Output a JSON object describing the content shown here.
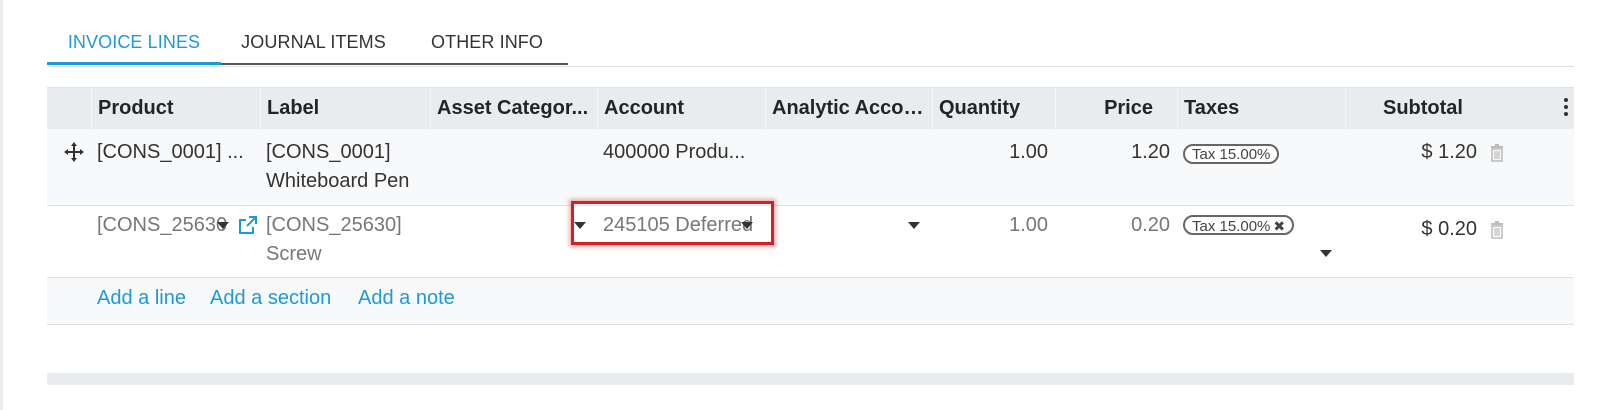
{
  "tabs": [
    {
      "label": "INVOICE LINES",
      "active": true
    },
    {
      "label": "JOURNAL ITEMS",
      "active": false
    },
    {
      "label": "OTHER INFO",
      "active": false
    }
  ],
  "columns": {
    "product": "Product",
    "label": "Label",
    "asset_category": "Asset Categor...",
    "account": "Account",
    "analytic_account": "Analytic Accou...",
    "quantity": "Quantity",
    "price": "Price",
    "taxes": "Taxes",
    "subtotal": "Subtotal"
  },
  "rows": [
    {
      "product": "[CONS_0001] ...",
      "label_line1": "[CONS_0001]",
      "label_line2": "Whiteboard Pen",
      "account": "400000 Produ...",
      "quantity": "1.00",
      "price": "1.20",
      "tax": "Tax 15.00%",
      "subtotal": "$ 1.20"
    },
    {
      "product": "[CONS_25630",
      "label_line1": "[CONS_25630]",
      "label_line2": "Screw",
      "account": "245105 Deferred",
      "quantity": "1.00",
      "price": "0.20",
      "tax": "Tax 15.00%",
      "subtotal": "$ 0.20"
    }
  ],
  "actions": {
    "add_line": "Add a line",
    "add_section": "Add a section",
    "add_note": "Add a note"
  },
  "colors": {
    "accent": "#1e9ad6",
    "highlight": "#d61f26"
  }
}
